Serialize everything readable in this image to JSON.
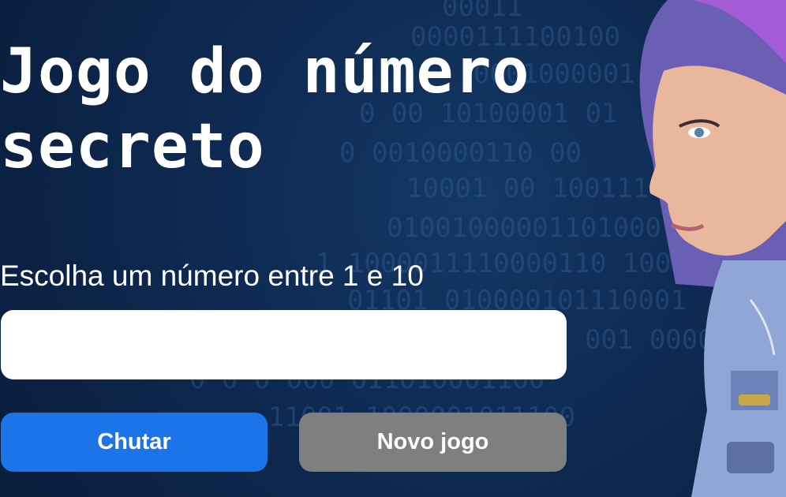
{
  "header": {
    "title": "Jogo do número secreto"
  },
  "prompt": {
    "text": "Escolha um número entre 1 e 10"
  },
  "guess_input": {
    "value": "",
    "placeholder": ""
  },
  "buttons": {
    "guess_label": "Chutar",
    "new_game_label": "Novo jogo"
  },
  "decor": {
    "background_icon": "binary-code-background",
    "illustration_icon": "robot-girl-illustration"
  },
  "colors": {
    "background": "#0e2a52",
    "primary_button": "#1b75e8",
    "secondary_button": "#7f7f7f",
    "text": "#ffffff"
  }
}
